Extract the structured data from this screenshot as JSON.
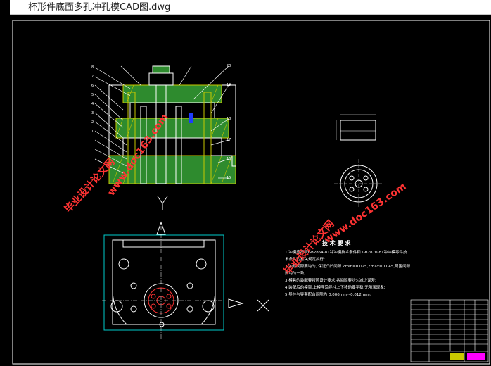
{
  "window": {
    "title": "杯形件底面多孔冲孔模CAD图.dwg"
  },
  "drawing": {
    "tech_req_title": "技 术 要 求",
    "tech_req_lines": [
      "1.冲模应符合GB2854-81冲冲模技术条件和 GB2870-81冲冲模零件技",
      "   术条件的有关规定执行;",
      "2.冲裁间隙要均匀, 保证凸凹间隙 Zmin=0.025,Zmax=0.045,周围间隙",
      "   要均匀一致;",
      "3.模具的装配要按照设计要求,各间隙要均匀减少误差;",
      "4.装配后的模架,上模座沿导柱上下移动要平稳,无阻滞现象;",
      "5.导柱与导套配合间隙为 0.006mm~0.012mm。"
    ],
    "axis_y": "Y",
    "axis_x": "X",
    "watermarks": [
      "毕业设计论文网",
      "www.doc163.com",
      "毕业设计论文网",
      "www.doc163.com"
    ]
  },
  "colors": {
    "background": "#000000",
    "line_white": "#ffffff",
    "hatch_green": "#2e8b2e",
    "hatch_yellow": "#c8c800",
    "frame_cyan": "#00cccc",
    "watermark": "#ff3333",
    "accent_blue": "#1e3cff"
  }
}
